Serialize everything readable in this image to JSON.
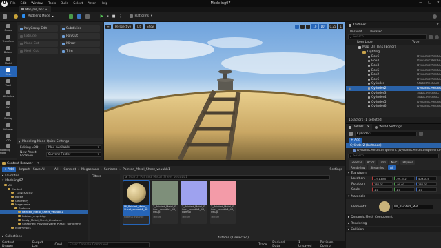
{
  "window": {
    "logo": "U",
    "tab": "Map_Oil_Tank",
    "tab_modified": "•",
    "title": "Modeling07",
    "controls": [
      "—",
      "□",
      "✕"
    ]
  },
  "menu": [
    "File",
    "Edit",
    "Window",
    "Tools",
    "Build",
    "Select",
    "Actor",
    "Help"
  ],
  "toolbar": {
    "mode": "Modeling Mode",
    "platforms": "Platforms",
    "play": "▶",
    "pause": "⏸",
    "stop": "■",
    "more": "⋮"
  },
  "tool_categories": [
    {
      "name": "Create",
      "icon": "cube-icon"
    },
    {
      "name": "Transform",
      "icon": "move-icon"
    },
    {
      "name": "Deform",
      "icon": "deform-icon"
    },
    {
      "name": "Model",
      "icon": "model-icon"
    },
    {
      "name": "Mesh",
      "icon": "mesh-icon"
    },
    {
      "name": "Voxel",
      "icon": "voxel-icon"
    },
    {
      "name": "Attributes",
      "icon": "attributes-icon"
    },
    {
      "name": "UVs",
      "icon": "uv-icon"
    },
    {
      "name": "Baking",
      "icon": "bake-icon"
    },
    {
      "name": "Volumes",
      "icon": "volume-icon"
    },
    {
      "name": "LODs",
      "icon": "lod-icon"
    },
    {
      "name": "Modeling Mode",
      "icon": "wrench-icon"
    }
  ],
  "tools_grid": [
    [
      "PolyGroup Edit",
      "Subdivide"
    ],
    [
      "Extrude",
      "PolyCut"
    ],
    [
      "Plane Cut",
      "Mirror"
    ],
    [
      "Mesh Cut",
      "Trim"
    ]
  ],
  "quick_settings": {
    "header": "Modeling Mode Quick Settings",
    "editing_lod_label": "Editing LOD",
    "editing_lod_value": "Max Available",
    "new_asset_label": "New Asset Location",
    "new_asset_value": "Current Folder"
  },
  "viewport": {
    "menu": "≡",
    "perspective": "Perspective",
    "lit": "Lit",
    "show": "Show",
    "grid": "10",
    "angle": "10°",
    "scale": "0.25",
    "cam": "1"
  },
  "outliner": {
    "title": "Outliner",
    "filter_tabs": [
      "Unsaved",
      "Unsaved"
    ],
    "search_placeholder": "Search...",
    "col_label": "Item Label",
    "col_type": "Type",
    "map_name": "Map_Oil_Tank (Editor)",
    "folder": "Lighting",
    "items": [
      {
        "label": "Box6",
        "type": "DynamicMeshA"
      },
      {
        "label": "Box4",
        "type": "DynamicMeshA"
      },
      {
        "label": "Box3",
        "type": "DynamicMeshA"
      },
      {
        "label": "Box5",
        "type": "DynamicMeshA"
      },
      {
        "label": "Box2",
        "type": "DynamicMeshA"
      },
      {
        "label": "Box6",
        "type": "DynamicMeshA"
      },
      {
        "label": "Cylinder",
        "type": "StaticMeshAct"
      },
      {
        "label": "Cylinder2",
        "type": "DynamicMeshA"
      },
      {
        "label": "Cylinder3",
        "type": "StaticMeshAct"
      },
      {
        "label": "Cylinder4",
        "type": "StaticMeshAct"
      },
      {
        "label": "Cylinder5",
        "type": "DynamicMeshA"
      },
      {
        "label": "Cylinder6",
        "type": "DynamicMeshA"
      }
    ],
    "footer": "16 actors (1 selected)"
  },
  "details": {
    "tab_details": "Details",
    "tab_world": "World Settings",
    "actor_name": "Cylinder2",
    "add": "+ Add",
    "instance": "Cylinder2 (Instance)",
    "component": "DynamicMeshComponent (DynamicMeshComponent0)",
    "search_placeholder": "Search",
    "tabs": [
      "General",
      "Actor",
      "LOD",
      "Misc",
      "Physics"
    ],
    "tabs2": [
      "Rendering",
      "Streaming",
      "All"
    ],
    "transform_header": "Transform",
    "rows": [
      {
        "label": "Location",
        "x": "-241.885",
        "y": "-99.352",
        "z": "409.075"
      },
      {
        "label": "Rotation",
        "x": "180.0°",
        "y": "-90.0°",
        "z": "180.0°"
      },
      {
        "label": "Scale",
        "x": "1.0",
        "y": "1.0",
        "z": "1.0"
      }
    ],
    "materials_header": "Materials",
    "element_label": "Element 0",
    "material_name": "MI_Painted_Met",
    "dmc_header": "Dynamic Mesh Component",
    "rendering_header": "Rendering",
    "collision_header": "Collision"
  },
  "content_browser": {
    "title": "Content Browser",
    "add": "+ Add",
    "import": "Import",
    "save_all": "Save All",
    "path": [
      "All",
      "Content",
      "Megascans",
      "Surfaces",
      "Painted_Metal_Sheet_veuubb1"
    ],
    "settings": "Settings",
    "favorites": "Favorites",
    "project": "Modeling07",
    "tree": [
      {
        "label": "All",
        "depth": 0
      },
      {
        "label": "Content",
        "depth": 1
      },
      {
        "label": "_GENERATED",
        "depth": 2
      },
      {
        "label": "Bottle",
        "depth": 2
      },
      {
        "label": "Geometry",
        "depth": 2
      },
      {
        "label": "Megascans",
        "depth": 2
      },
      {
        "label": "Surfaces",
        "depth": 3
      },
      {
        "label": "Painted_Metal_Sheet_veuubb1",
        "depth": 4
      },
      {
        "label": "Rubber_ungetdgp",
        "depth": 4
      },
      {
        "label": "Rusty_Metal_Sheet_tjtkwbcne",
        "depth": 4
      },
      {
        "label": "Scratched_Polypropylene_Plastic_ucHlenmy",
        "depth": 4
      },
      {
        "label": "ModPhysics",
        "depth": 2
      }
    ],
    "collections": "Collections",
    "filters": "Filters",
    "search_placeholder": "Search Painted_Metal_Sheet_veuubb1",
    "assets": [
      {
        "name": "MI_Painted_Metal_Sheet_veuubb1_4K",
        "type": "Material Instance",
        "color": "#c8b27a"
      },
      {
        "name": "T_Painted_Metal_Sheet_veuubb1_4K_ORDp",
        "type": "Texture",
        "color": "#7e8f7a"
      },
      {
        "name": "T_Painted_Metal_Sheet_veuubb1_4K_Normal",
        "type": "Texture",
        "color": "#9ea2ef"
      },
      {
        "name": "T_Painted_Metal_Sheet_veuubb1_4K_ORDp",
        "type": "Texture",
        "color": "#f39ba8"
      }
    ],
    "footer": "4 items (1 selected)"
  },
  "status": {
    "content_drawer": "Content Drawer",
    "output_log": "Output Log",
    "cmd": "Cmd",
    "cmd_placeholder": "Enter Console Command",
    "trace": "Trace",
    "derived": "Derived Data",
    "unsaved": "1 Unsaved",
    "revision": "Revision Control"
  },
  "colors": {
    "accent": "#2665b8",
    "panel": "#242424",
    "dark": "#151515",
    "header": "#1a1a1a"
  }
}
